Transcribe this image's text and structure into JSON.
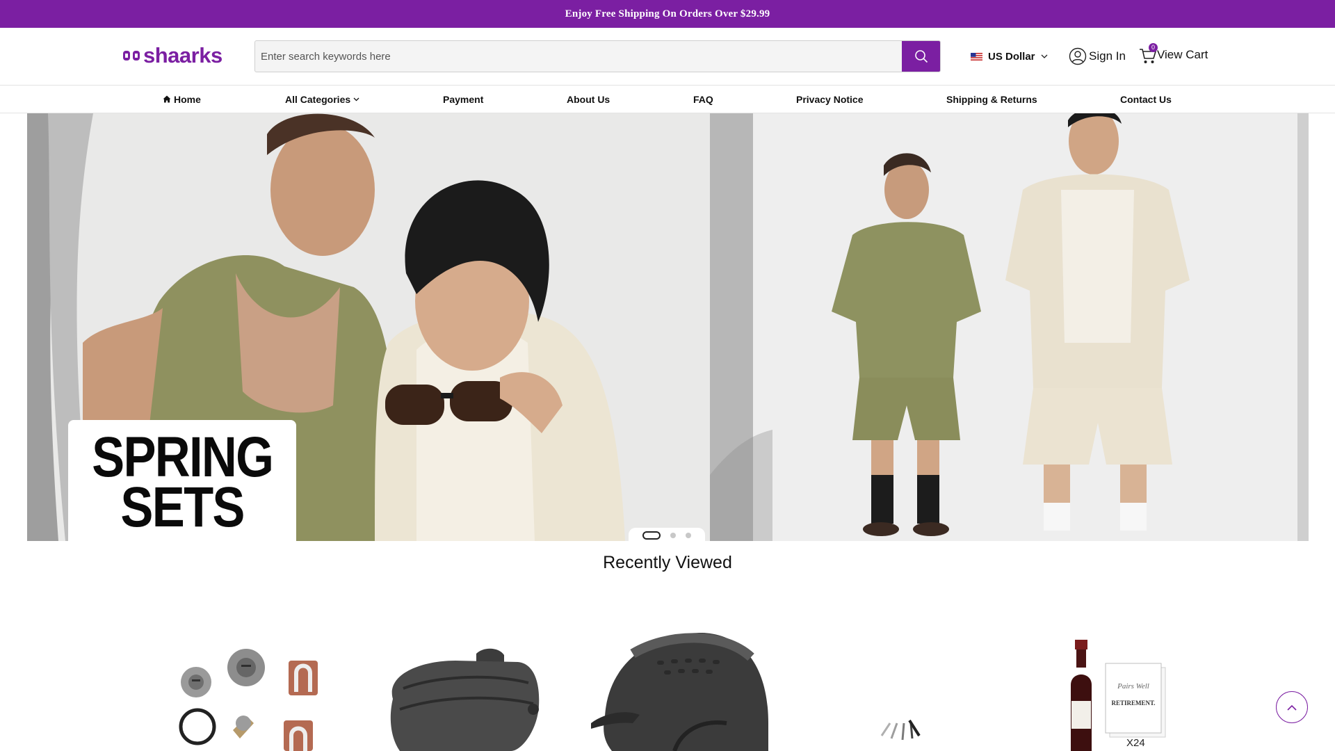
{
  "promo": {
    "text": "Enjoy Free Shipping On Orders Over $29.99"
  },
  "header": {
    "logo_text": "shaarks",
    "search_placeholder": "Enter search keywords here",
    "currency_label": "US Dollar",
    "signin_label": "Sign In",
    "cart_label": "View Cart",
    "cart_count": "0"
  },
  "nav": {
    "items": [
      {
        "label": "Home",
        "icon": "home-icon"
      },
      {
        "label": "All Categories",
        "icon": "chevron-down-icon"
      },
      {
        "label": "Payment"
      },
      {
        "label": "About Us"
      },
      {
        "label": "FAQ"
      },
      {
        "label": "Privacy Notice"
      },
      {
        "label": "Shipping & Returns"
      },
      {
        "label": "Contact Us"
      }
    ]
  },
  "hero": {
    "card_line1": "SPRING",
    "card_line2": "SETS",
    "slide_count": 3,
    "active_slide": 1
  },
  "recent": {
    "title": "Recently Viewed",
    "products": [
      {
        "image": "lock-cylinder-set-image"
      },
      {
        "image": "black-plastic-part-image"
      },
      {
        "image": "riding-helmet-image"
      },
      {
        "image": "small-pins-image"
      },
      {
        "image": "wine-retirement-label-image",
        "label": "X24"
      }
    ]
  },
  "colors": {
    "brand": "#7b1fa2",
    "nav_text": "#111111",
    "background": "#ffffff"
  }
}
